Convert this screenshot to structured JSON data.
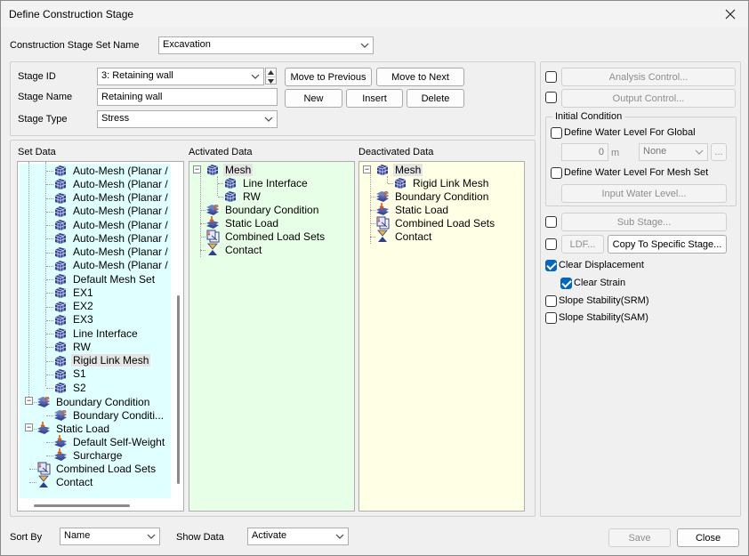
{
  "window": {
    "title": "Define Construction Stage"
  },
  "stage_set": {
    "label": "Construction Stage Set Name",
    "value": "Excavation"
  },
  "stage": {
    "id_label": "Stage ID",
    "id_value": "3: Retaining wall",
    "name_label": "Stage Name",
    "name_value": "Retaining wall",
    "type_label": "Stage Type",
    "type_value": "Stress",
    "move_prev": "Move to Previous",
    "move_next": "Move to Next",
    "new": "New",
    "insert": "Insert",
    "delete": "Delete"
  },
  "set_data": {
    "label": "Set Data",
    "items": [
      {
        "text": "Auto-Mesh (Planar /",
        "icon": "mesh-icon"
      },
      {
        "text": "Auto-Mesh (Planar /",
        "icon": "mesh-icon"
      },
      {
        "text": "Auto-Mesh (Planar /",
        "icon": "mesh-icon"
      },
      {
        "text": "Auto-Mesh (Planar /",
        "icon": "mesh-icon"
      },
      {
        "text": "Auto-Mesh (Planar /",
        "icon": "mesh-icon"
      },
      {
        "text": "Auto-Mesh (Planar /",
        "icon": "mesh-icon"
      },
      {
        "text": "Auto-Mesh (Planar /",
        "icon": "mesh-icon"
      },
      {
        "text": "Auto-Mesh (Planar /",
        "icon": "mesh-icon"
      },
      {
        "text": "Default Mesh Set",
        "icon": "mesh-icon"
      },
      {
        "text": "EX1",
        "icon": "mesh-icon"
      },
      {
        "text": "EX2",
        "icon": "mesh-icon"
      },
      {
        "text": "EX3",
        "icon": "mesh-icon"
      },
      {
        "text": "Line Interface",
        "icon": "mesh-icon"
      },
      {
        "text": "RW",
        "icon": "mesh-icon"
      },
      {
        "text": "Rigid Link Mesh",
        "icon": "mesh-icon"
      },
      {
        "text": "S1",
        "icon": "mesh-icon"
      },
      {
        "text": "S2",
        "icon": "mesh-icon"
      },
      {
        "text": "Boundary Condition",
        "icon": "boundary-icon"
      },
      {
        "text": "Boundary Conditi...",
        "icon": "boundary-icon"
      },
      {
        "text": "Static Load",
        "icon": "static-load-icon"
      },
      {
        "text": "Default Self-Weight",
        "icon": "static-load-icon"
      },
      {
        "text": "Surcharge",
        "icon": "static-load-icon"
      },
      {
        "text": "Combined Load Sets",
        "icon": "combined-load-icon"
      },
      {
        "text": "Contact",
        "icon": "contact-icon"
      }
    ]
  },
  "activated": {
    "label": "Activated Data",
    "items": [
      {
        "text": "Mesh",
        "icon": "mesh-icon"
      },
      {
        "text": "Line Interface",
        "icon": "mesh-icon"
      },
      {
        "text": "RW",
        "icon": "mesh-icon"
      },
      {
        "text": "Boundary Condition",
        "icon": "boundary-icon"
      },
      {
        "text": "Static Load",
        "icon": "static-load-icon"
      },
      {
        "text": "Combined Load Sets",
        "icon": "combined-load-icon"
      },
      {
        "text": "Contact",
        "icon": "contact-icon"
      }
    ]
  },
  "deactivated": {
    "label": "Deactivated Data",
    "items": [
      {
        "text": "Mesh",
        "icon": "mesh-icon"
      },
      {
        "text": "Rigid Link Mesh",
        "icon": "mesh-icon"
      },
      {
        "text": "Boundary Condition",
        "icon": "boundary-icon"
      },
      {
        "text": "Static Load",
        "icon": "static-load-icon"
      },
      {
        "text": "Combined Load Sets",
        "icon": "combined-load-icon"
      },
      {
        "text": "Contact",
        "icon": "contact-icon"
      }
    ]
  },
  "right": {
    "analysis_control": "Analysis Control...",
    "output_control": "Output Control...",
    "initial_condition": "Initial Condition",
    "water_global": "Define Water Level For Global",
    "water_value": "0",
    "water_unit": "m",
    "water_combo": "None",
    "ellipsis": "...",
    "water_mesh": "Define Water Level For Mesh Set",
    "input_water": "Input Water Level...",
    "sub_stage": "Sub Stage...",
    "ldf": "LDF...",
    "copy_specific": "Copy To Specific Stage...",
    "clear_displacement": "Clear Displacement",
    "clear_strain": "Clear Strain",
    "slope_srm": "Slope Stability(SRM)",
    "slope_sam": "Slope Stability(SAM)"
  },
  "footer": {
    "sort_label": "Sort By",
    "sort_value": "Name",
    "show_label": "Show Data",
    "show_value": "Activate",
    "save": "Save",
    "close": "Close"
  }
}
